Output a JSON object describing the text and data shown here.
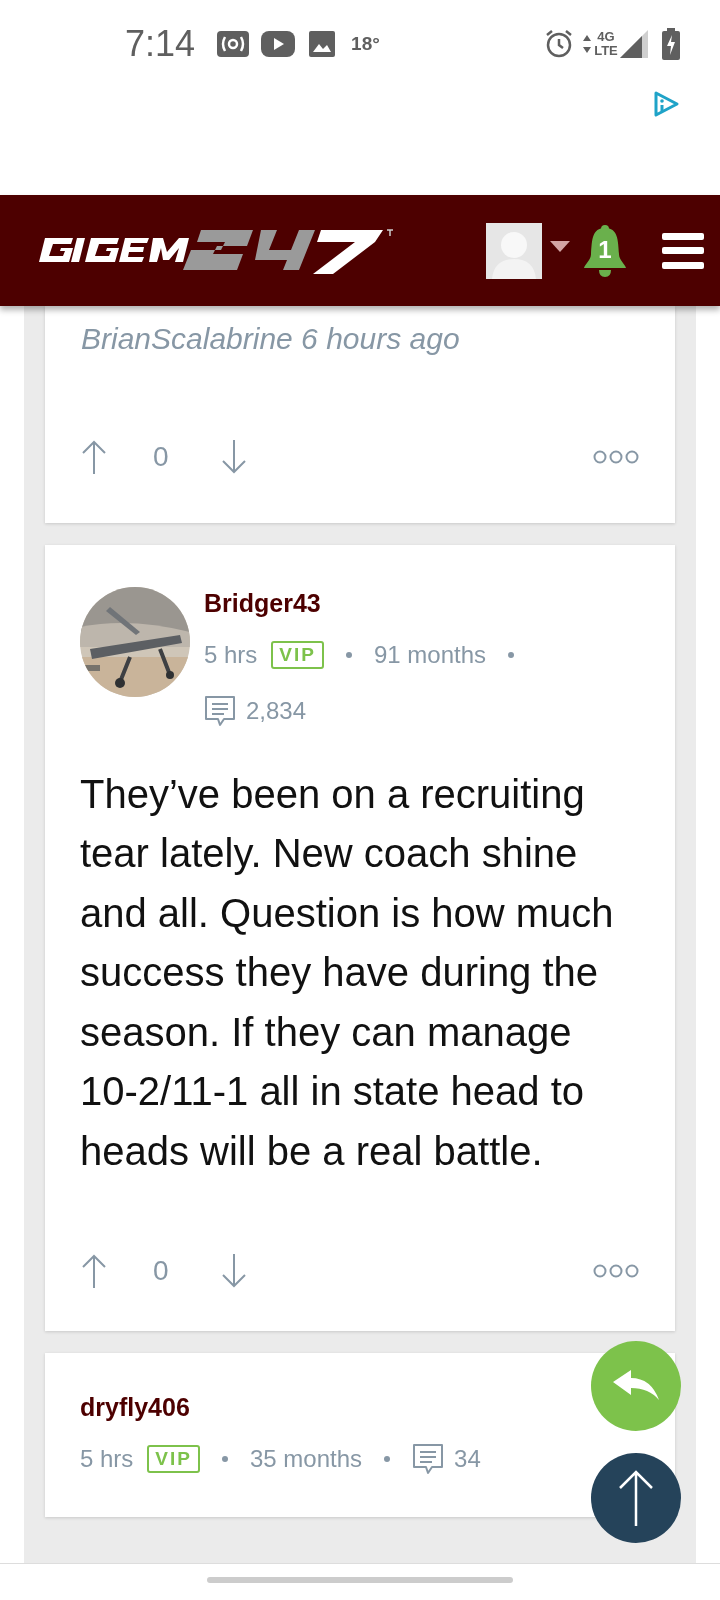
{
  "status_bar": {
    "time": "7:14",
    "temperature": "18°",
    "network": "4G LTE"
  },
  "header": {
    "notifications": "1"
  },
  "posts": [
    {
      "kind": "partial",
      "edited_note": "BrianScalabrine 6 hours ago",
      "votes": "0"
    },
    {
      "kind": "full",
      "username": "Bridger43",
      "age": "5 hrs",
      "badge": "VIP",
      "tenure": "91 months",
      "post_count": "2,834",
      "body": "They’ve been on a recruiting tear lately. New coach shine and all. Question is how much success they have during the season. If they can manage 10-2/11-1 all in state head to heads will be a real battle.",
      "votes": "0"
    },
    {
      "kind": "top",
      "username": "dryfly406",
      "age": "5 hrs",
      "badge": "VIP",
      "tenure": "35 months",
      "post_count": "34"
    }
  ]
}
